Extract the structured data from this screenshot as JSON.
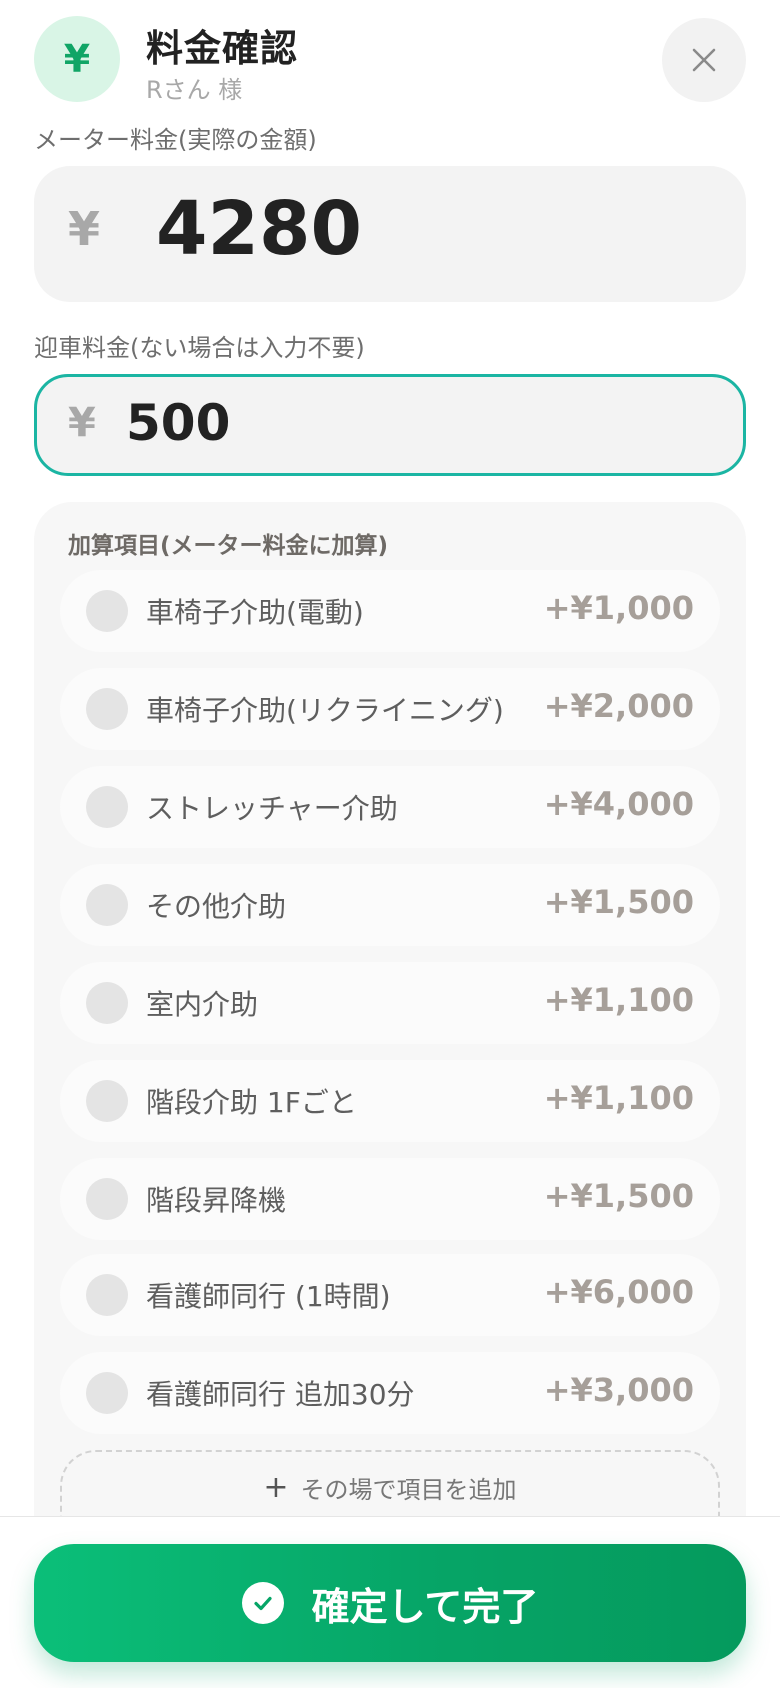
{
  "header": {
    "badge_icon": "yen-icon",
    "badge_symbol": "¥",
    "title": "料金確認",
    "subtitle": "Rさん 様",
    "close_icon": "close-icon"
  },
  "meter": {
    "label": "メーター料金(実際の金額)",
    "currency": "¥",
    "value": "4280"
  },
  "pickup": {
    "label": "迎車料金(ない場合は入力不要)",
    "currency": "¥",
    "value": "500"
  },
  "surcharges": {
    "title": "加算項目(メーター料金に加算)",
    "items": [
      {
        "label": "車椅子介助(電動)",
        "price": "+¥1,000"
      },
      {
        "label": "車椅子介助(リクライニング)",
        "price": "+¥2,000"
      },
      {
        "label": "ストレッチャー介助",
        "price": "+¥4,000"
      },
      {
        "label": "その他介助",
        "price": "+¥1,500"
      },
      {
        "label": "室内介助",
        "price": "+¥1,100"
      },
      {
        "label": "階段介助 1Fごと",
        "price": "+¥1,100"
      },
      {
        "label": "階段昇降機",
        "price": "+¥1,500"
      },
      {
        "label": "看護師同行 (1時間)",
        "price": "+¥6,000"
      },
      {
        "label": "看護師同行 追加30分",
        "price": "+¥3,000"
      }
    ],
    "add_plus": "+",
    "add_label": "その場で項目を追加"
  },
  "footer": {
    "confirm_label": "確定して完了",
    "confirm_icon": "check-icon"
  },
  "colors": {
    "accent": "#06a567",
    "input_focus": "#1bb5a3",
    "badge_bg": "#d9f5e6"
  }
}
